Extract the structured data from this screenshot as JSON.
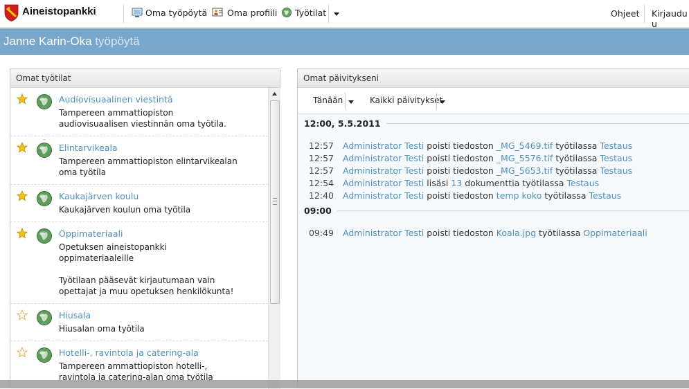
{
  "header": {
    "brand": "Aineistopankki",
    "nav": [
      {
        "label": "Oma työpöytä",
        "icon": "desktop-icon"
      },
      {
        "label": "Oma profiili",
        "icon": "profile-icon"
      },
      {
        "label": "Työtilat",
        "icon": "globe-icon"
      }
    ],
    "help": "Ohjeet",
    "logout": "Kirjaudu u"
  },
  "title": {
    "name": "Janne Karin-Oka",
    "suffix": "työpöytä"
  },
  "workspaces": {
    "heading": "Omat työtilat",
    "items": [
      {
        "title": "Audiovisuaalinen viestintä",
        "desc": "Tampereen ammattiopiston\naudiovisuaalisen viestinnän oma työtila.",
        "starred": true
      },
      {
        "title": "Elintarvikeala",
        "desc": "Tampereen ammattiopiston elintarvikealan\noma työtila",
        "starred": true
      },
      {
        "title": "Kaukajärven koulu",
        "desc": "Kaukajärven koulun oma työtila",
        "starred": true
      },
      {
        "title": "Oppimateriaali",
        "desc": "Opetuksen aineistopankki\noppimateriaaleille\n\n    Työtilaan pääsevät kirjautumaan vain\n    opettajat ja muu opetuksen henkilökunta!",
        "starred": true
      },
      {
        "title": "Hiusala",
        "desc": "Hiusalan oma työtila",
        "starred": false
      },
      {
        "title": "Hotelli-, ravintola ja catering-ala",
        "desc": "Tampereen ammattiopiston hotelli-,\nravintola ja catering-alan oma työtila",
        "starred": false
      }
    ]
  },
  "updates": {
    "heading": "Omat päivitykseni",
    "filter_time": "Tänään",
    "filter_type": "Kaikki päivitykset",
    "groups": [
      {
        "header": "12:00, 5.5.2011",
        "rows": [
          {
            "time": "12:57",
            "user": "Administrator Testi",
            "verb": "poisti tiedoston",
            "object": "_MG_5469.tif",
            "mid": "työtilassa",
            "space": "Testaus"
          },
          {
            "time": "12:57",
            "user": "Administrator Testi",
            "verb": "poisti tiedoston",
            "object": "_MG_5576.tif",
            "mid": "työtilassa",
            "space": "Testaus"
          },
          {
            "time": "12:57",
            "user": "Administrator Testi",
            "verb": "poisti tiedoston",
            "object": "_MG_5653.tif",
            "mid": "työtilassa",
            "space": "Testaus"
          },
          {
            "time": "12:54",
            "user": "Administrator Testi",
            "verb": "lisäsi",
            "object": "13",
            "mid": "dokumenttia työtilassa",
            "space": "Testaus"
          },
          {
            "time": "12:40",
            "user": "Administrator Testi",
            "verb": "poisti tiedoston",
            "object": "temp koko",
            "mid": "työtilassa",
            "space": "Testaus"
          }
        ]
      },
      {
        "header": "09:00",
        "rows": [
          {
            "time": "09:49",
            "user": "Administrator Testi",
            "verb": "poisti tiedoston",
            "object": "Koala.jpg",
            "mid": "työtilassa",
            "space": "Oppimateriaali"
          }
        ]
      }
    ]
  },
  "colors": {
    "accent": "#79a7cc",
    "link": "#4f90bd",
    "star": "#f2c21b"
  }
}
